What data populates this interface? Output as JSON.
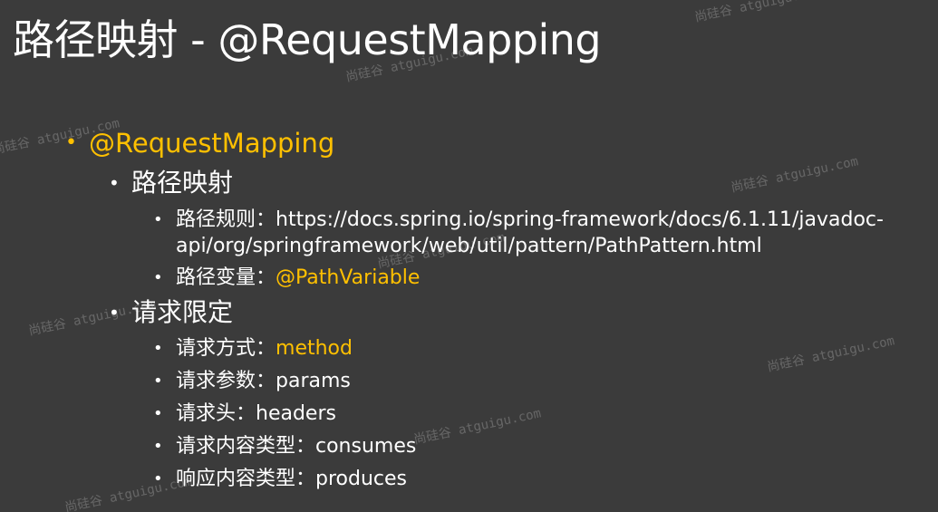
{
  "title": "路径映射 - @RequestMapping",
  "bullet_char": "•",
  "items": {
    "l1": "@RequestMapping",
    "l2a": "路径映射",
    "l3a": "路径规则：https://docs.spring.io/spring-framework/docs/6.1.11/javadoc-api/org/springframework/web/util/pattern/PathPattern.html",
    "l3b_label": "路径变量：",
    "l3b_value": "@PathVariable",
    "l2b": "请求限定",
    "l3c_label": "请求方式：",
    "l3c_value": "method",
    "l3d": "请求参数：params",
    "l3e": "请求头：headers",
    "l3f": "请求内容类型：consumes",
    "l3g": "响应内容类型：produces"
  },
  "watermark": "尚硅谷 atguigu.com",
  "colors": {
    "background": "#3b3b3b",
    "text": "#ffffff",
    "accent": "#ffc000"
  }
}
